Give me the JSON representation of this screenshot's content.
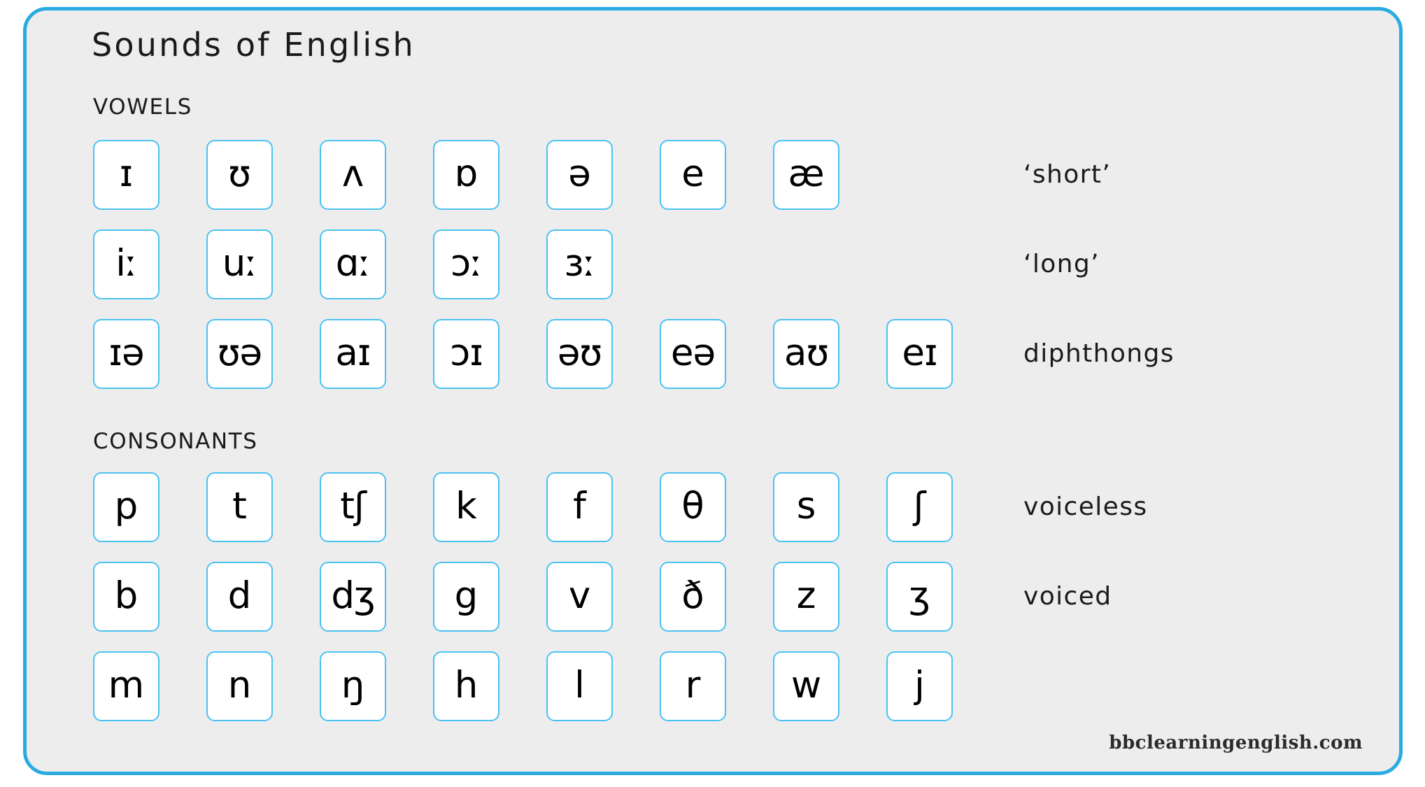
{
  "card": {
    "title": "Sounds of English",
    "border_color": "#29abe2",
    "background_color": "#ededed",
    "tile_border_color": "#4cc2f1",
    "tile_background_color": "#ffffff"
  },
  "sections": {
    "vowels": {
      "heading": "VOWELS",
      "rows": [
        {
          "id": "short",
          "label": "‘short’",
          "symbols": [
            "ɪ",
            "ʊ",
            "ʌ",
            "ɒ",
            "ə",
            "e",
            "æ"
          ]
        },
        {
          "id": "long",
          "label": "‘long’",
          "symbols": [
            "iː",
            "uː",
            "ɑː",
            "ɔː",
            "ɜː"
          ]
        },
        {
          "id": "diphthongs",
          "label": "diphthongs",
          "symbols": [
            "ɪə",
            "ʊə",
            "aɪ",
            "ɔɪ",
            "əʊ",
            "eə",
            "aʊ",
            "eɪ"
          ]
        }
      ]
    },
    "consonants": {
      "heading": "CONSONANTS",
      "rows": [
        {
          "id": "voiceless",
          "label": "voiceless",
          "symbols": [
            "p",
            "t",
            "tʃ",
            "k",
            "f",
            "θ",
            "s",
            "ʃ"
          ]
        },
        {
          "id": "voiced",
          "label": "voiced",
          "symbols": [
            "b",
            "d",
            "dʒ",
            "g",
            "v",
            "ð",
            "z",
            "ʒ"
          ]
        },
        {
          "id": "other",
          "label": "",
          "symbols": [
            "m",
            "n",
            "ŋ",
            "h",
            "l",
            "r",
            "w",
            "j"
          ]
        }
      ]
    }
  },
  "footer": {
    "attribution": "bbclearningenglish.com"
  }
}
